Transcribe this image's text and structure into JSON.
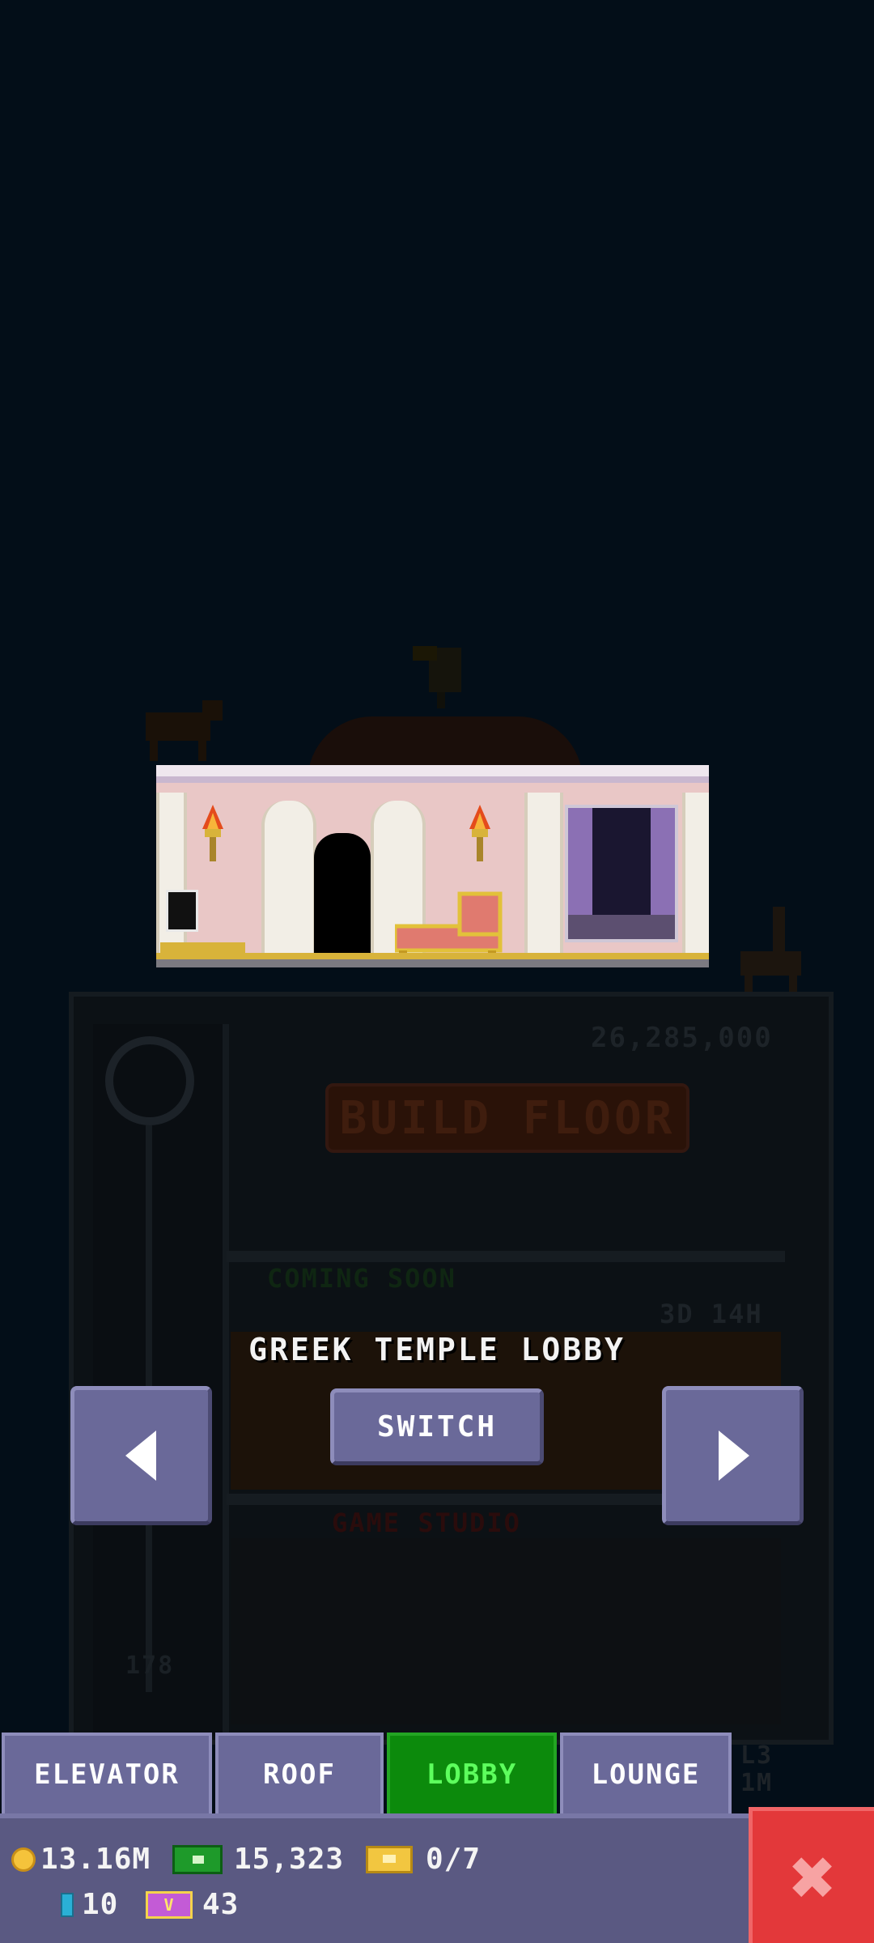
{
  "background": {
    "price": "26,285,000",
    "build_label": "BUILD FLOOR",
    "coming_soon": "COMING SOON",
    "timer": "3D 14H",
    "game_studio": "GAME STUDIO",
    "floor_number": "178",
    "side_tag_top": "L3",
    "side_tag_bottom": "1M"
  },
  "lobby": {
    "name": "GREEK TEMPLE LOBBY",
    "switch_label": "SWITCH",
    "prev_icon": "left-arrow-icon",
    "next_icon": "right-arrow-icon"
  },
  "tabs": [
    {
      "label": "ELEVATOR",
      "active": false
    },
    {
      "label": "ROOF",
      "active": false
    },
    {
      "label": "LOBBY",
      "active": true
    },
    {
      "label": "LOUNGE",
      "active": false
    }
  ],
  "status": {
    "coins": "13.16M",
    "bux": "15,323",
    "tickets": "0/7",
    "gems": "10",
    "vip": "43"
  },
  "colors": {
    "accent": "#6a6999",
    "active_tab": "#0c8a0c",
    "close": "#e3383a"
  }
}
